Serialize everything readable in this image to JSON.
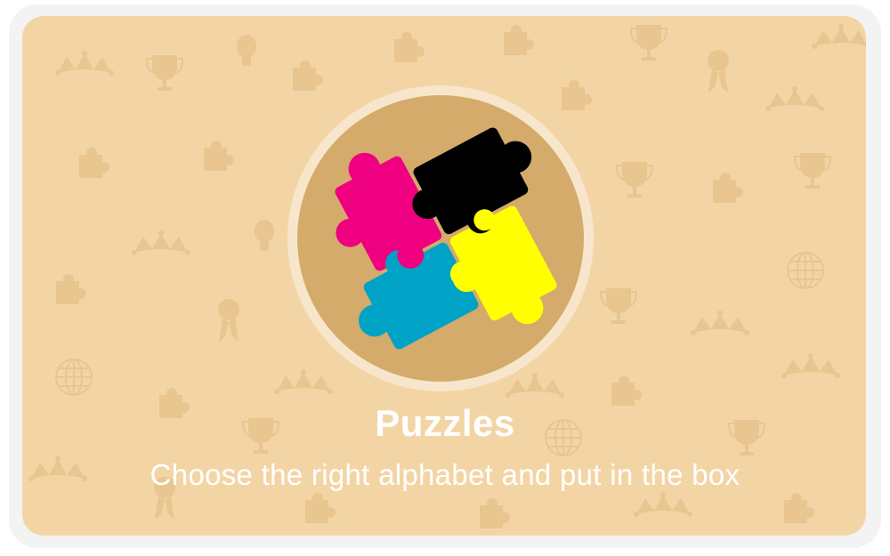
{
  "game": {
    "title": "Puzzles",
    "subtitle": "Choose the right alphabet and put in the box"
  },
  "colors": {
    "card_bg": "#f3d5a5",
    "icon_tint": "#e9c58f",
    "emblem_ring": "#f8e6cc",
    "emblem_fill": "#d4ab6a",
    "piece_magenta": "#ef0081",
    "piece_cyan": "#00a2c6",
    "piece_black": "#000000",
    "piece_yellow": "#ffff00"
  },
  "decor_icons": [
    "crown-icon",
    "trophy-icon",
    "lightbulb-icon",
    "puzzle-piece-icon",
    "ribbon-icon",
    "globe-icon"
  ]
}
